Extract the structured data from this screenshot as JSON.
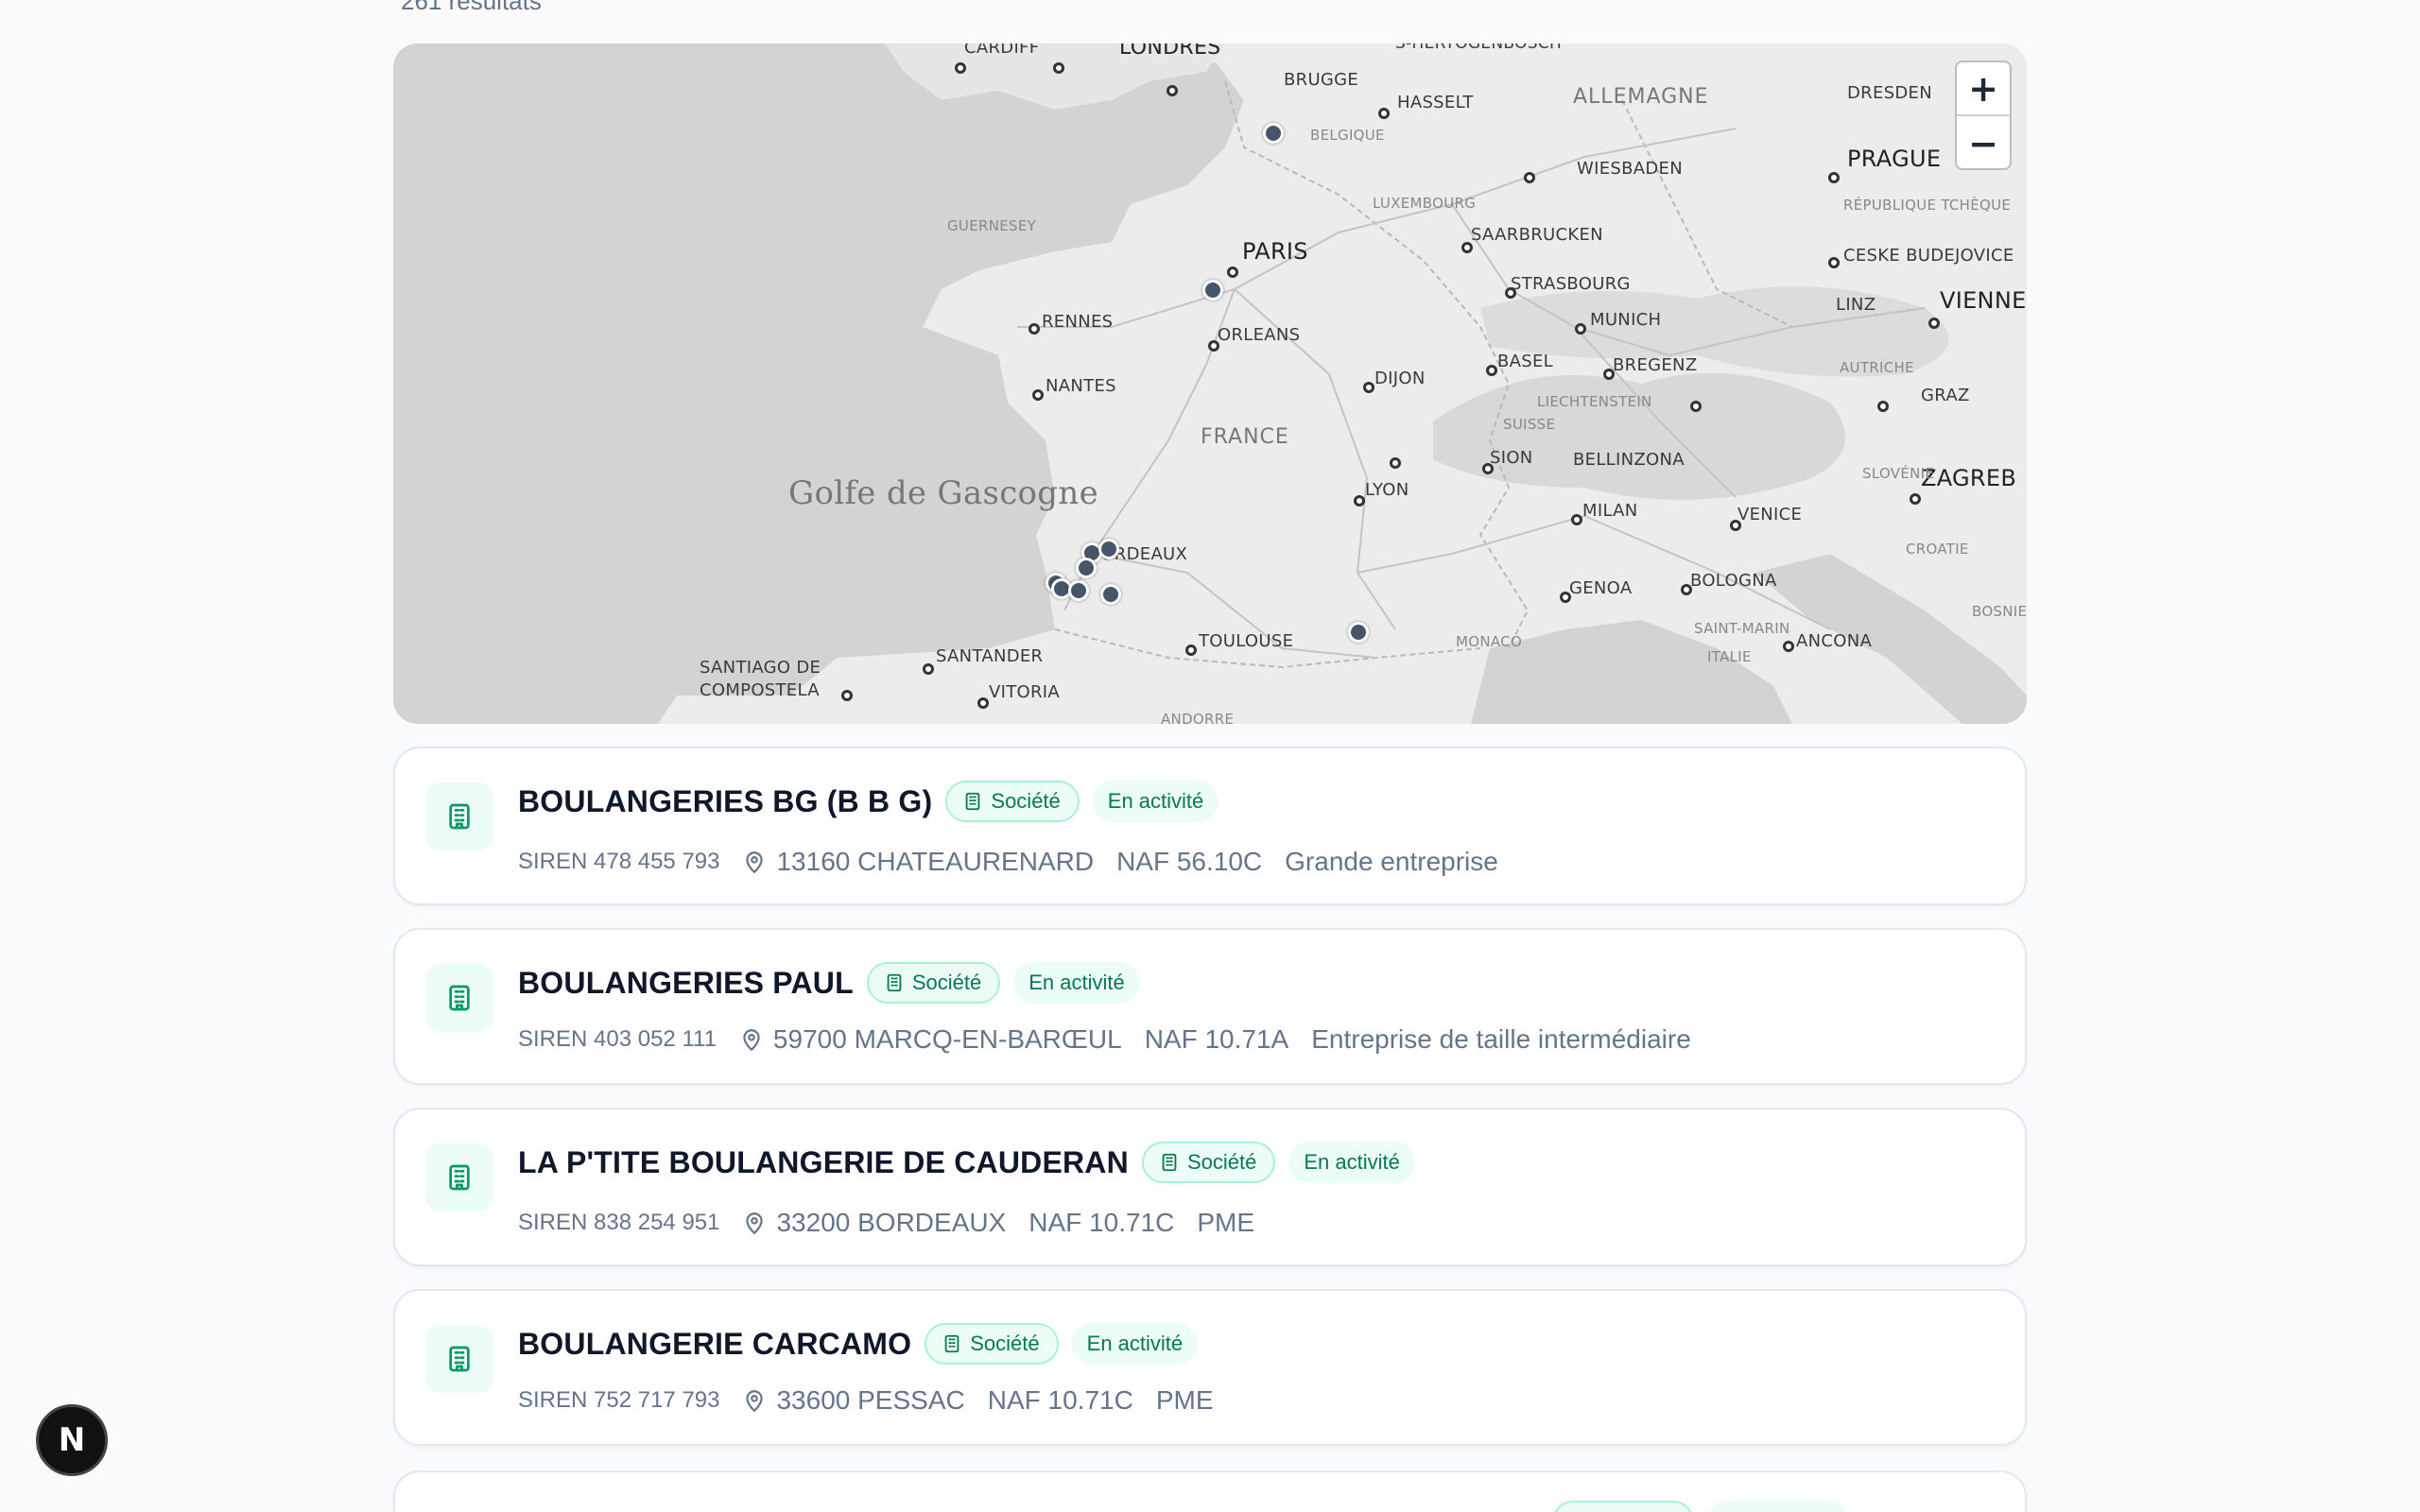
{
  "results_count": "261 résultats",
  "map": {
    "zoom_in": "+",
    "zoom_out": "−",
    "labels": {
      "cardiff": "CARDIFF",
      "londres": "LONDRES",
      "brugge": "BRUGGE",
      "hertogenbosch": "S-HERTOGENBOSCH",
      "hasselt": "HASSELT",
      "allemagne": "ALLEMAGNE",
      "dresden": "DRESDEN",
      "belgique": "BELGIQUE",
      "prague": "PRAGUE",
      "wiesbaden": "WIESBADEN",
      "luxembourg": "LUXEMBOURG",
      "rep_tcheque": "RÉPUBLIQUE TCHÈQUE",
      "guernesey": "GUERNESEY",
      "paris": "PARIS",
      "saarbrucken": "SAARBRUCKEN",
      "ceske": "CESKE BUDEJOVICE",
      "strasbourg": "STRASBOURG",
      "linz": "LINZ",
      "vienne": "VIENNE",
      "rennes": "RENNES",
      "orleans": "ORLEANS",
      "munich": "MUNICH",
      "dijon": "DIJON",
      "basel": "BASEL",
      "bregenz": "BREGENZ",
      "autriche": "AUTRICHE",
      "nantes": "NANTES",
      "liechtenstein": "LIECHTENSTEIN",
      "graz": "GRAZ",
      "suisse": "SUISSE",
      "france": "FRANCE",
      "sion": "SION",
      "bellinzona": "BELLINZONA",
      "zagreb": "ZAGREB",
      "slovenie": "SLOVÉNIE",
      "golfe": "Golfe de Gascogne",
      "lyon": "LYON",
      "milan": "MILAN",
      "venice": "VENICE",
      "croatie": "CROATIE",
      "bordeaux": "BORDEAUX",
      "genoa": "GENOA",
      "bologna": "BOLOGNA",
      "saint_marin": "SAINT-MARIN",
      "bosnie": "BOSNIE-HERZÉ",
      "toulouse": "TOULOUSE",
      "monaco": "MONACO",
      "ancona": "ANCONA",
      "italie": "ITALIE",
      "santander": "SANTANDER",
      "santiago": "SANTIAGO DE",
      "compostela": "COMPOSTELA",
      "vitoria": "VITORIA",
      "andorre": "ANDORRE"
    }
  },
  "results": [
    {
      "name": "BOULANGERIES BG (B B G)",
      "type": "Société",
      "status": "En activité",
      "siren": "SIREN 478 455 793",
      "location": "13160 CHATEAURENARD",
      "naf": "NAF 56.10C",
      "size": "Grande entreprise"
    },
    {
      "name": "BOULANGERIES PAUL",
      "type": "Société",
      "status": "En activité",
      "siren": "SIREN 403 052 111",
      "location": "59700 MARCQ-EN-BARŒUL",
      "naf": "NAF 10.71A",
      "size": "Entreprise de taille intermédiaire"
    },
    {
      "name": "LA P'TITE BOULANGERIE DE CAUDERAN",
      "type": "Société",
      "status": "En activité",
      "siren": "SIREN 838 254 951",
      "location": "33200 BORDEAUX",
      "naf": "NAF 10.71C",
      "size": "PME"
    },
    {
      "name": "BOULANGERIE CARCAMO",
      "type": "Société",
      "status": "En activité",
      "siren": "SIREN 752 717 793",
      "location": "33600 PESSAC",
      "naf": "NAF 10.71C",
      "size": "PME"
    }
  ],
  "devtools_badge": "N",
  "colors": {
    "accent": "#047857",
    "badge_bg": "#ecfdf5",
    "muted": "#64748b",
    "marker": "#475569"
  }
}
